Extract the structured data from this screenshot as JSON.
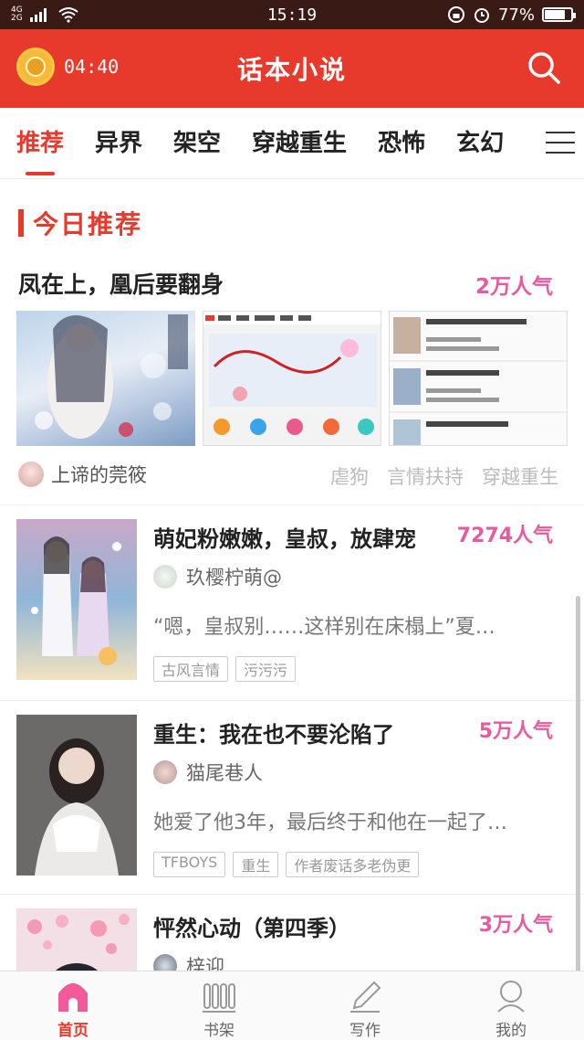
{
  "status_bar": {
    "network_top": "4G",
    "network_bottom": "2G",
    "time": "15:19",
    "battery": "77%",
    "battery_level": 0.77
  },
  "header": {
    "timer": "04:40",
    "title": "话本小说"
  },
  "tabs": [
    "推荐",
    "异界",
    "架空",
    "穿越重生",
    "恐怖",
    "玄幻"
  ],
  "section_title": "今日推荐",
  "featured": {
    "title": "凤在上，凰后要翻身",
    "popularity": "2万人气",
    "author": "上谛的莞筱",
    "tags": [
      "虐狗",
      "言情扶持",
      "穿越重生"
    ]
  },
  "books": [
    {
      "title": "萌妃粉嫩嫩，皇叔，放肆宠",
      "popularity": "7274人气",
      "author": "玖樱柠萌@",
      "description": "“嗯，皇叔别……这样别在床榻上”夏…",
      "tags": [
        "古风言情",
        "污污污"
      ]
    },
    {
      "title": "重生：我在也不要沦陷了",
      "popularity": "5万人气",
      "author": "猫尾巷人",
      "description": "她爱了他3年，最后终于和他在一起了…",
      "tags": [
        "TFBOYS",
        "重生",
        "作者废话多老伪更"
      ]
    },
    {
      "title": "怦然心动（第四季）",
      "popularity": "3万人气",
      "author": "梓迎",
      "description": "",
      "tags": []
    }
  ],
  "bottom_nav": [
    "首页",
    "书架",
    "写作",
    "我的"
  ],
  "colors": {
    "brand": "#e83a2c",
    "popularity": "#e85aa0"
  }
}
